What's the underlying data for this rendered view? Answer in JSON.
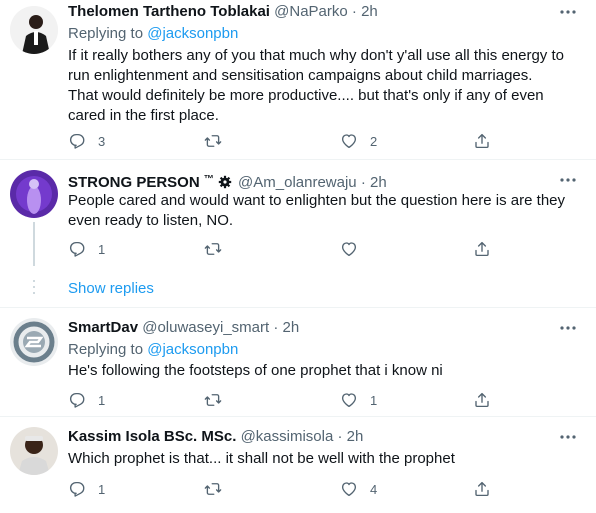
{
  "colors": {
    "accent": "#1d9bf0",
    "muted": "#536471",
    "text": "#0f1419",
    "divider": "#eff3f4"
  },
  "icons": {
    "reply": "reply-icon",
    "retweet": "retweet-icon",
    "like": "heart-icon",
    "share": "share-icon",
    "more": "more-icon"
  },
  "replying_prefix": "Replying to",
  "show_replies": "Show replies",
  "tweets": [
    {
      "name": "Thelomen Tartheno Toblakai",
      "handle": "@NaParko",
      "time": "2h",
      "replying_to": "@jacksonpbn",
      "text": [
        "If it really bothers any of you that much why don't y'all use all this energy to",
        "run enlightenment and sensitisation campaigns about child marriages.",
        "That would definitely be more productive.... but that's only if any of even",
        "cared in the first place."
      ],
      "replies": "3",
      "retweets": "",
      "likes": "2"
    },
    {
      "name": "STRONG PERSON",
      "name_suffix": "™",
      "handle": "@Am_olanrewaju",
      "time": "2h",
      "text": [
        "People cared and would want to enlighten but the question here is are they",
        "even ready to listen, NO."
      ],
      "replies": "1",
      "retweets": "",
      "likes": ""
    },
    {
      "name": "SmartDav",
      "handle": "@oluwaseyi_smart",
      "time": "2h",
      "replying_to": "@jacksonpbn",
      "text": [
        "He's following the footsteps of one prophet that i know ni"
      ],
      "replies": "1",
      "retweets": "",
      "likes": "1"
    },
    {
      "name": "Kassim Isola BSc. MSc.",
      "handle": "@kassimisola",
      "time": "2h",
      "text": [
        "Which prophet is that... it shall not be well with the prophet"
      ],
      "replies": "1",
      "retweets": "",
      "likes": "4"
    }
  ]
}
